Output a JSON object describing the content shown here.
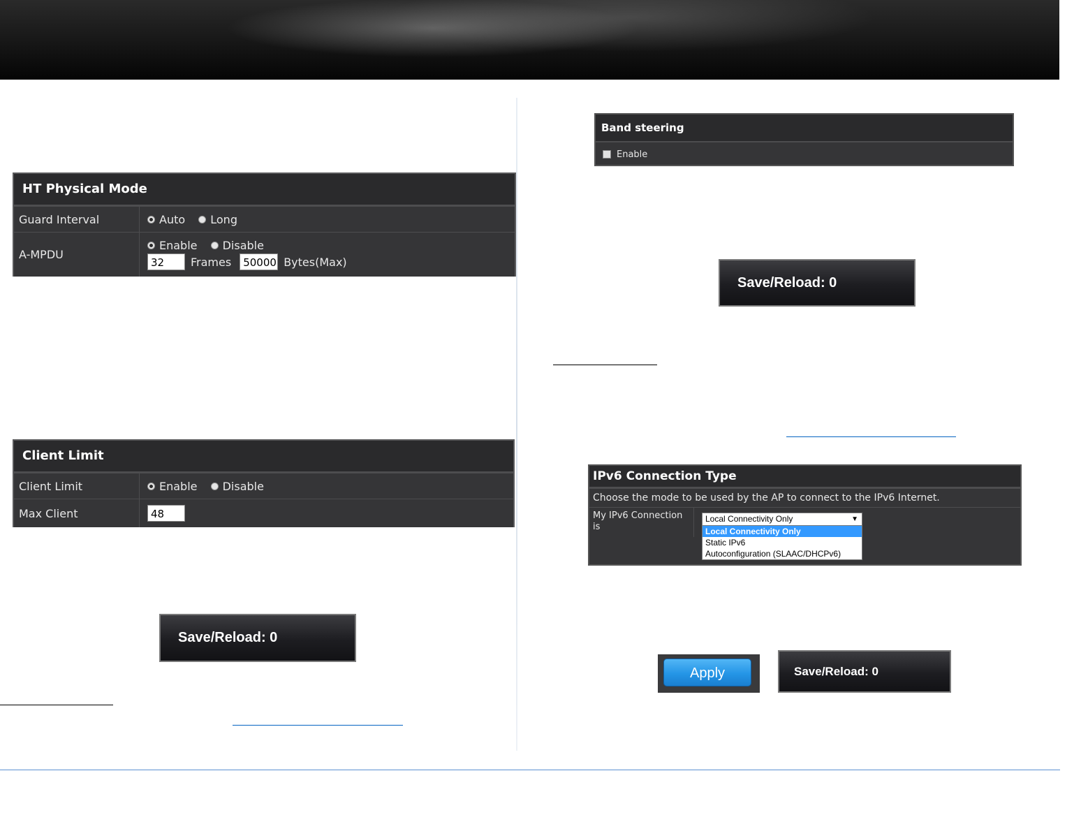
{
  "ht_physical_mode": {
    "title": "HT Physical Mode",
    "guard_interval": {
      "label": "Guard Interval",
      "options": [
        "Auto",
        "Long"
      ],
      "selected": "Auto"
    },
    "ampdu": {
      "label": "A-MPDU",
      "options": [
        "Enable",
        "Disable"
      ],
      "selected": "Enable",
      "frames_value": "32",
      "frames_label": "Frames",
      "bytes_value": "50000",
      "bytes_label": "Bytes(Max)"
    }
  },
  "client_limit": {
    "title": "Client Limit",
    "limit": {
      "label": "Client Limit",
      "options": [
        "Enable",
        "Disable"
      ],
      "selected": "Enable"
    },
    "max_client": {
      "label": "Max Client",
      "value": "48"
    }
  },
  "band_steering": {
    "title": "Band steering",
    "enable_label": "Enable",
    "checked": false
  },
  "ipv6": {
    "title": "IPv6 Connection Type",
    "description": "Choose the mode to be used by the AP to connect to the IPv6 Internet.",
    "label_line1": "My IPv6 Connection",
    "label_line2": "is",
    "selected": "Local Connectivity Only",
    "options": [
      "Local Connectivity Only",
      "Static IPv6",
      "Autoconfiguration (SLAAC/DHCPv6)"
    ]
  },
  "buttons": {
    "save_reload": "Save/Reload: 0",
    "apply": "Apply"
  },
  "colors": {
    "link_blue": "#0563c1",
    "apply_blue": "#2495e6",
    "footer_rule": "#5b8fd1"
  }
}
